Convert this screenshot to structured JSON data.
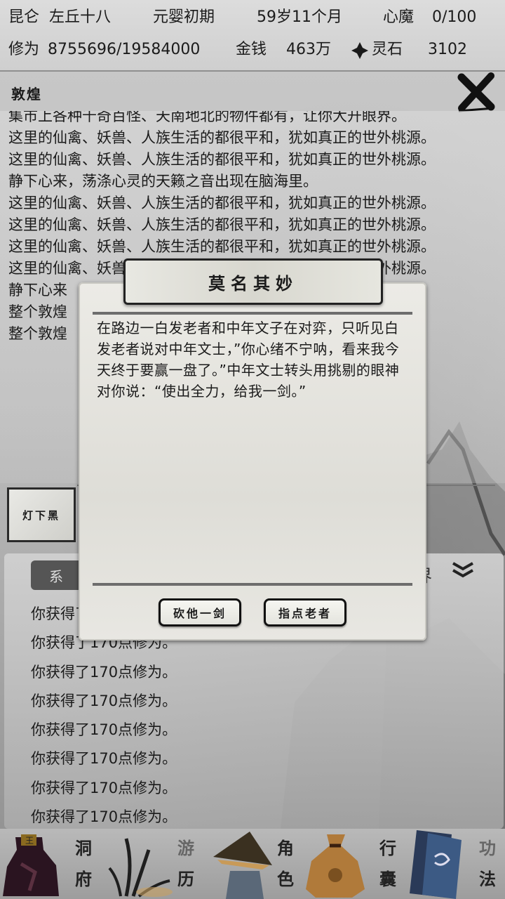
{
  "status": {
    "region": "昆仑",
    "name": "左丘十八",
    "realm": "元婴初期",
    "age": "59岁11个月",
    "heart_demon_label": "心魔",
    "heart_demon_value": "0/100",
    "cultivation_label": "修为",
    "cultivation_value": "8755696/19584000",
    "money_label": "金钱",
    "money_value": "463万",
    "spirit_stone_label": "灵石",
    "spirit_stone_value": "3102"
  },
  "location": {
    "title": "敦煌"
  },
  "story_log": [
    "集市上各种千奇百怪、天南地北的物件都有，让你大开眼界。",
    "这里的仙禽、妖兽、人族生活的都很平和，犹如真正的世外桃源。",
    "这里的仙禽、妖兽、人族生活的都很平和，犹如真正的世外桃源。",
    "静下心来，荡涤心灵的天籁之音出现在脑海里。",
    "这里的仙禽、妖兽、人族生活的都很平和，犹如真正的世外桃源。",
    "这里的仙禽、妖兽、人族生活的都很平和，犹如真正的世外桃源。",
    "这里的仙禽、妖兽、人族生活的都很平和，犹如真正的世外桃源。",
    "这里的仙禽、妖兽、人族生活的都很平和，犹如真正的世外桃源。",
    "静下心来",
    "整个敦煌",
    "整个敦煌"
  ],
  "event_thumb": {
    "label": "灯下黑"
  },
  "message_panel": {
    "tab_system": "系",
    "tab_right": "界",
    "messages": [
      "你获得了170点修为。",
      "你获得了170点修为。",
      "你获得了170点修为。",
      "你获得了170点修为。",
      "你获得了170点修为。",
      "你获得了170点修为。",
      "你获得了170点修为。",
      "你获得了170点修为。"
    ]
  },
  "modal": {
    "title": "莫名其妙",
    "body": "在路边一白发老者和中年文子在对弈，只听见白发老者说对中年文士，”你心绪不宁呐，看来我今天终于要赢一盘了。”中年文士转头用挑剔的眼神对你说：“使出全力，给我一剑。”",
    "choice_1": "砍他一剑",
    "choice_2": "指点老者"
  },
  "nav": [
    {
      "label_1": "洞",
      "label_2": "府"
    },
    {
      "label_1": "游",
      "label_2": "历"
    },
    {
      "label_1": "角",
      "label_2": "色"
    },
    {
      "label_1": "行",
      "label_2": "囊"
    },
    {
      "label_1": "功",
      "label_2": "法"
    }
  ]
}
